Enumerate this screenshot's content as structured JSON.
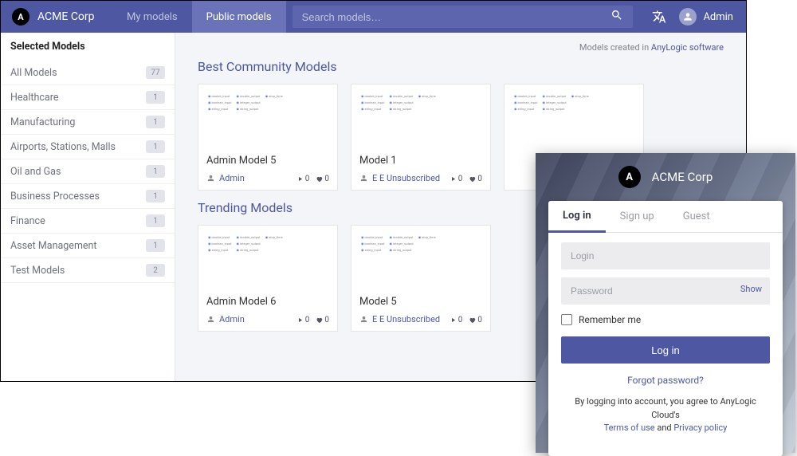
{
  "topbar": {
    "brand_letter": "A",
    "brand_name": "ACME Corp",
    "nav": [
      {
        "label": "My models"
      },
      {
        "label": "Public models"
      }
    ],
    "search_placeholder": "Search models…",
    "user_label": "Admin"
  },
  "sidebar": {
    "title": "Selected Models",
    "items": [
      {
        "label": "All Models",
        "count": "77"
      },
      {
        "label": "Healthcare",
        "count": "1"
      },
      {
        "label": "Manufacturing",
        "count": "1"
      },
      {
        "label": "Airports, Stations, Malls",
        "count": "1"
      },
      {
        "label": "Oil and Gas",
        "count": "1"
      },
      {
        "label": "Business Processes",
        "count": "1"
      },
      {
        "label": "Finance",
        "count": "1"
      },
      {
        "label": "Asset Management",
        "count": "1"
      },
      {
        "label": "Test Models",
        "count": "2"
      }
    ]
  },
  "main": {
    "credits_prefix": "Models created in ",
    "credits_link": "AnyLogic software",
    "sections": [
      {
        "title": "Best Community Models",
        "cards": [
          {
            "title": "Admin Model 5",
            "author": "Admin",
            "runs": "0",
            "likes": "0"
          },
          {
            "title": "Model 1",
            "author": "E E Unsubscribed",
            "runs": "0",
            "likes": "0"
          },
          {
            "title": "",
            "author": "",
            "runs": "",
            "likes": ""
          }
        ]
      },
      {
        "title": "Trending Models",
        "cards": [
          {
            "title": "Admin Model 6",
            "author": "Admin",
            "runs": "0",
            "likes": "0"
          },
          {
            "title": "Model 5",
            "author": "E E Unsubscribed",
            "runs": "0",
            "likes": "0"
          }
        ]
      }
    ]
  },
  "login": {
    "brand_letter": "A",
    "brand_name": "ACME Corp",
    "tabs": {
      "login": "Log in",
      "signup": "Sign up",
      "guest": "Guest"
    },
    "login_placeholder": "Login",
    "password_placeholder": "Password",
    "show_label": "Show",
    "remember_label": "Remember me",
    "submit_label": "Log in",
    "forgot_label": "Forgot password?",
    "legal_prefix": "By logging into account, you agree to AnyLogic Cloud's ",
    "legal_terms": "Terms of use",
    "legal_and": " and ",
    "legal_privacy": "Privacy policy"
  }
}
